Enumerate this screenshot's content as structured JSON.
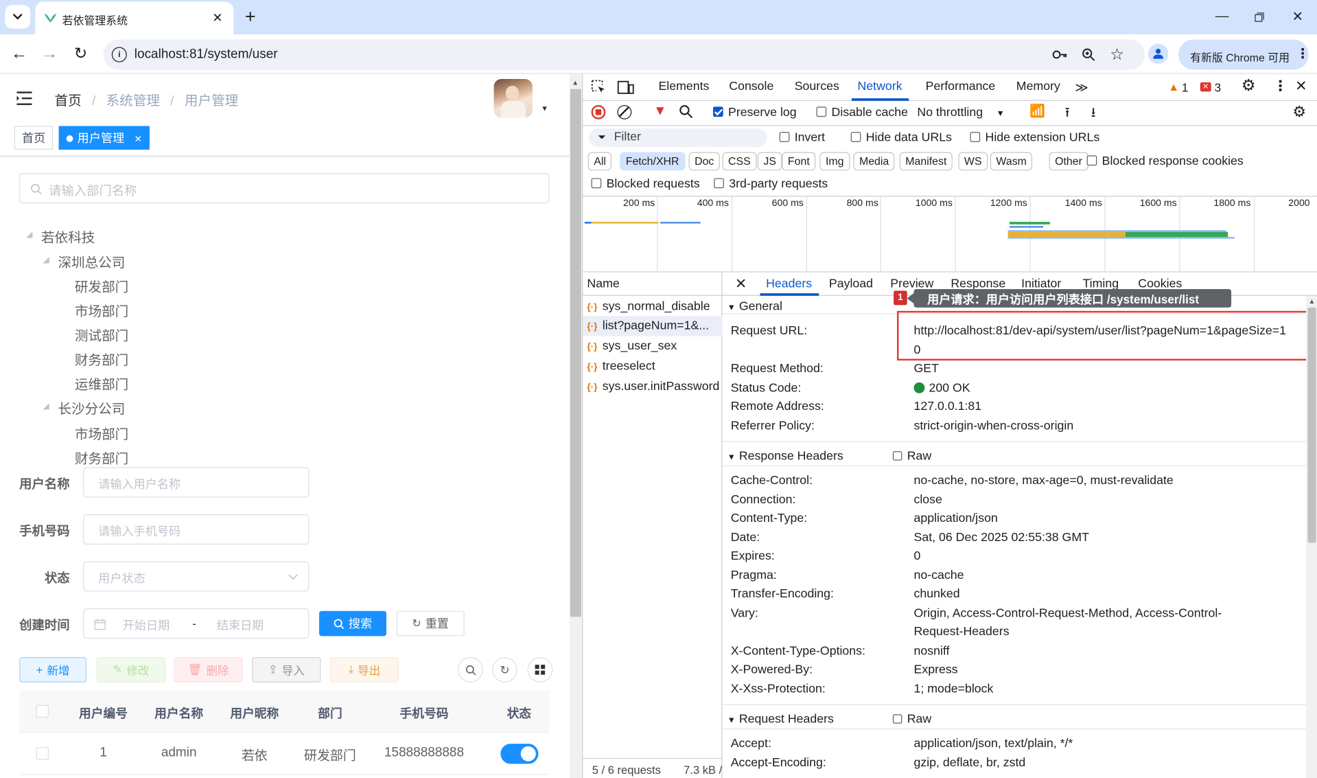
{
  "browser": {
    "tab_title": "若依管理系统",
    "url": "localhost:81/system/user",
    "chrome_badge": "有新版 Chrome 可用"
  },
  "app": {
    "breadcrumb": [
      "首页",
      "系统管理",
      "用户管理"
    ],
    "tags": [
      {
        "label": "首页"
      },
      {
        "label": "用户管理"
      }
    ],
    "dept_search_placeholder": "请输入部门名称",
    "tree": {
      "root": "若依科技",
      "branch1": "深圳总公司",
      "branch1_children": [
        "研发部门",
        "市场部门",
        "测试部门",
        "财务部门",
        "运维部门"
      ],
      "branch2": "长沙分公司",
      "branch2_children": [
        "市场部门",
        "财务部门"
      ]
    },
    "form": {
      "username_label": "用户名称",
      "username_placeholder": "请输入用户名称",
      "phone_label": "手机号码",
      "phone_placeholder": "请输入手机号码",
      "status_label": "状态",
      "status_placeholder": "用户状态",
      "created_label": "创建时间",
      "start_placeholder": "开始日期",
      "date_sep": "-",
      "end_placeholder": "结束日期",
      "search_btn": "搜索",
      "reset_btn": "重置"
    },
    "actions": {
      "add": "新增",
      "edit": "修改",
      "delete": "删除",
      "import": "导入",
      "export": "导出"
    },
    "table": {
      "headers": [
        "用户编号",
        "用户名称",
        "用户昵称",
        "部门",
        "手机号码",
        "状态"
      ],
      "rows": [
        {
          "id": "1",
          "username": "admin",
          "nickname": "若依",
          "dept": "研发部门",
          "phone": "15888888888",
          "enabled": true
        }
      ]
    }
  },
  "devtools": {
    "tabs": [
      "Elements",
      "Console",
      "Sources",
      "Network",
      "Performance",
      "Memory"
    ],
    "active_tab": "Network",
    "warnings": "1",
    "errors": "3",
    "toolbar": {
      "preserve_log": "Preserve log",
      "disable_cache": "Disable cache",
      "throttling": "No throttling"
    },
    "filter": {
      "placeholder": "Filter",
      "invert": "Invert",
      "hide_data": "Hide data URLs",
      "hide_ext": "Hide extension URLs"
    },
    "types": [
      "All",
      "Fetch/XHR",
      "Doc",
      "CSS",
      "JS",
      "Font",
      "Img",
      "Media",
      "Manifest",
      "WS",
      "Wasm",
      "Other"
    ],
    "active_type": "Fetch/XHR",
    "blocked_cookies": "Blocked response cookies",
    "blocked_requests": "Blocked requests",
    "third_party": "3rd-party requests",
    "timeline_ticks": [
      "200 ms",
      "400 ms",
      "600 ms",
      "800 ms",
      "1000 ms",
      "1200 ms",
      "1400 ms",
      "1600 ms",
      "1800 ms",
      "2000"
    ],
    "name_header": "Name",
    "requests": [
      "sys_normal_disable",
      "list?pageNum=1&...",
      "sys_user_sex",
      "treeselect",
      "sys.user.initPassword"
    ],
    "footer": {
      "count": "5 / 6 requests",
      "size": "7.3 kB /"
    },
    "detail_tabs": [
      "Headers",
      "Payload",
      "Preview",
      "Response",
      "Initiator",
      "Timing",
      "Cookies"
    ],
    "annotation": {
      "badge": "1",
      "text": "用户请求：用户访问用户列表接口 /system/user/list"
    },
    "general": {
      "title": "General",
      "request_url_label": "Request URL:",
      "request_url_line1": "http://localhost:81/dev-api/system/user/list?pageNum=1&pageSize=1",
      "request_url_line2": "0",
      "method_label": "Request Method:",
      "method": "GET",
      "status_label": "Status Code:",
      "status": "200 OK",
      "remote_label": "Remote Address:",
      "remote": "127.0.0.1:81",
      "referrer_label": "Referrer Policy:",
      "referrer": "strict-origin-when-cross-origin"
    },
    "response_headers": {
      "title": "Response Headers",
      "raw": "Raw",
      "items": [
        {
          "k": "Cache-Control:",
          "v": "no-cache, no-store, max-age=0, must-revalidate"
        },
        {
          "k": "Connection:",
          "v": "close"
        },
        {
          "k": "Content-Type:",
          "v": "application/json"
        },
        {
          "k": "Date:",
          "v": "Sat, 06 Dec 2025 02:55:38 GMT"
        },
        {
          "k": "Expires:",
          "v": "0"
        },
        {
          "k": "Pragma:",
          "v": "no-cache"
        },
        {
          "k": "Transfer-Encoding:",
          "v": "chunked"
        },
        {
          "k": "Vary:",
          "v": "Origin, Access-Control-Request-Method, Access-Control-"
        },
        {
          "k": "",
          "v": "Request-Headers"
        },
        {
          "k": "X-Content-Type-Options:",
          "v": "nosniff"
        },
        {
          "k": "X-Powered-By:",
          "v": "Express"
        },
        {
          "k": "X-Xss-Protection:",
          "v": "1; mode=block"
        }
      ]
    },
    "request_headers": {
      "title": "Request Headers",
      "raw": "Raw",
      "items": [
        {
          "k": "Accept:",
          "v": "application/json, text/plain, */*"
        },
        {
          "k": "Accept-Encoding:",
          "v": "gzip, deflate, br, zstd"
        }
      ]
    }
  },
  "colors": {
    "primary": "#1890ff",
    "chrome_bg": "#d3e3fd",
    "devtools_active": "#0b57d0",
    "highlight_box": "#e53935"
  }
}
